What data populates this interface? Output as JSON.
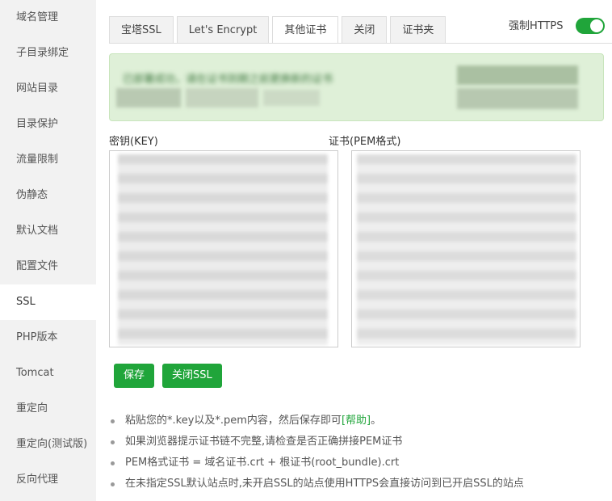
{
  "sidebar": {
    "items": [
      {
        "label": "域名管理"
      },
      {
        "label": "子目录绑定"
      },
      {
        "label": "网站目录"
      },
      {
        "label": "目录保护"
      },
      {
        "label": "流量限制"
      },
      {
        "label": "伪静态"
      },
      {
        "label": "默认文档"
      },
      {
        "label": "配置文件"
      },
      {
        "label": "SSL"
      },
      {
        "label": "PHP版本"
      },
      {
        "label": "Tomcat"
      },
      {
        "label": "重定向"
      },
      {
        "label": "重定向(测试版)"
      },
      {
        "label": "反向代理"
      }
    ],
    "active": "SSL"
  },
  "tabs": [
    {
      "label": "宝塔SSL"
    },
    {
      "label": "Let's Encrypt"
    },
    {
      "label": "其他证书"
    },
    {
      "label": "关闭"
    },
    {
      "label": "证书夹"
    }
  ],
  "active_tab": "其他证书",
  "force_https": {
    "label": "强制HTTPS",
    "enabled": true
  },
  "alert": {
    "text": "已部署成功，请在证书到期之前更换新的证书"
  },
  "key_label": "密钥(KEY)",
  "cert_label": "证书(PEM格式)",
  "buttons": {
    "save": "保存",
    "close_ssl": "关闭SSL"
  },
  "tips": [
    {
      "text": "粘贴您的*.key以及*.pem内容，然后保存即可",
      "link": "[帮助]",
      "suffix": "。"
    },
    {
      "text": "如果浏览器提示证书链不完整,请检查是否正确拼接PEM证书"
    },
    {
      "text": "PEM格式证书 = 域名证书.crt + 根证书(root_bundle).crt"
    },
    {
      "text": "在未指定SSL默认站点时,未开启SSL的站点使用HTTPS会直接访问到已开启SSL的站点"
    }
  ],
  "colors": {
    "accent": "#20a53a",
    "alert_bg": "#dff0d8",
    "sidebar_bg": "#f2f2f2"
  }
}
